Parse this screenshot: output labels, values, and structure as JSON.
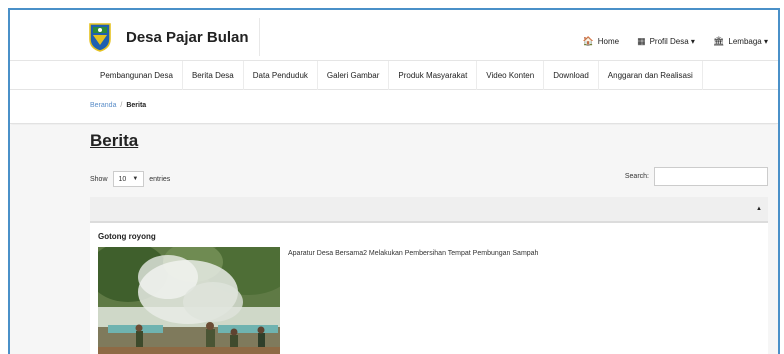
{
  "brand": {
    "title": "Desa Pajar Bulan"
  },
  "topnav": {
    "items": [
      {
        "icon": "home-icon",
        "glyph": "🏠",
        "label": "Home"
      },
      {
        "icon": "grid-icon",
        "glyph": "▦",
        "label": "Profil Desa ▾"
      },
      {
        "icon": "institution-icon",
        "glyph": "🏛",
        "label": "Lembaga ▾"
      }
    ]
  },
  "mainnav": {
    "items": [
      "Pembangunan Desa",
      "Berita Desa",
      "Data Penduduk",
      "Galeri Gambar",
      "Produk Masyarakat",
      "Video Konten",
      "Download",
      "Anggaran dan Realisasi"
    ]
  },
  "breadcrumb": {
    "home": "Beranda",
    "separator": "/",
    "current": "Berita"
  },
  "page": {
    "title": "Berita"
  },
  "table": {
    "show_label": "Show",
    "page_size": "10",
    "entries_label": "entries",
    "search_label": "Search:",
    "search_value": "",
    "rows": [
      {
        "title": "Gotong royong",
        "description": "Aparatur Desa Bersama2 Melakukan Pembersihan Tempat Pembungan Sampah"
      }
    ]
  },
  "colors": {
    "frame_border": "#4a90c8",
    "link": "#5a8dc8",
    "content_bg": "#f6f6f6"
  }
}
